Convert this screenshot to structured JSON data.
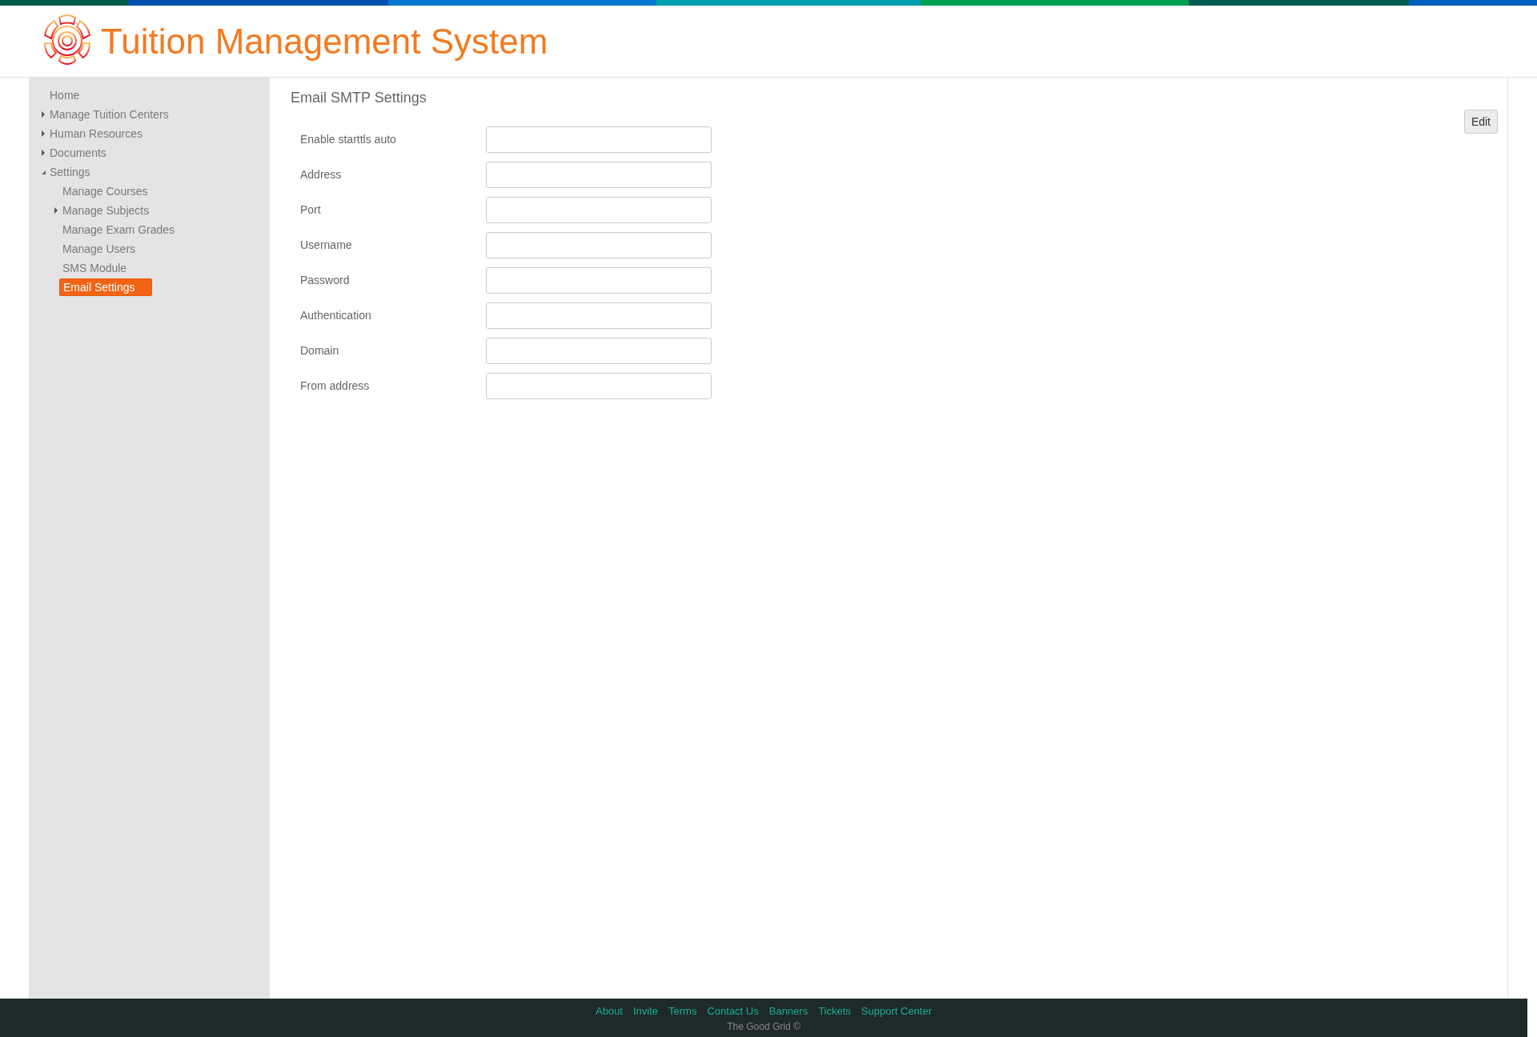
{
  "header": {
    "title": "Tuition Management System"
  },
  "sidebar": {
    "items": [
      {
        "label": "Home",
        "kind": "leaf",
        "selected": false
      },
      {
        "label": "Manage Tuition Centers",
        "kind": "folder",
        "expanded": false,
        "selected": false
      },
      {
        "label": "Human Resources",
        "kind": "folder",
        "expanded": false,
        "selected": false
      },
      {
        "label": "Documents",
        "kind": "folder",
        "expanded": false,
        "selected": false
      },
      {
        "label": "Settings",
        "kind": "folder",
        "expanded": true,
        "selected": false,
        "children": [
          {
            "label": "Manage Courses",
            "kind": "leaf",
            "selected": false
          },
          {
            "label": "Manage Subjects",
            "kind": "folder",
            "expanded": false,
            "selected": false
          },
          {
            "label": "Manage Exam Grades",
            "kind": "leaf",
            "selected": false
          },
          {
            "label": "Manage Users",
            "kind": "leaf",
            "selected": false
          },
          {
            "label": "SMS Module",
            "kind": "leaf",
            "selected": false
          },
          {
            "label": "Email Settings",
            "kind": "leaf",
            "selected": true
          }
        ]
      }
    ]
  },
  "page": {
    "title": "Email SMTP Settings",
    "edit_button": "Edit",
    "fields": [
      {
        "label": "Enable starttls auto"
      },
      {
        "label": "Address"
      },
      {
        "label": "Port"
      },
      {
        "label": "Username"
      },
      {
        "label": "Password"
      },
      {
        "label": "Authentication"
      },
      {
        "label": "Domain"
      },
      {
        "label": "From address"
      }
    ]
  },
  "footer": {
    "links": [
      "About",
      "Invite",
      "Terms",
      "Contact Us",
      "Banners",
      "Tickets",
      "Support Center"
    ],
    "copyright": "The Good Grid ©"
  }
}
